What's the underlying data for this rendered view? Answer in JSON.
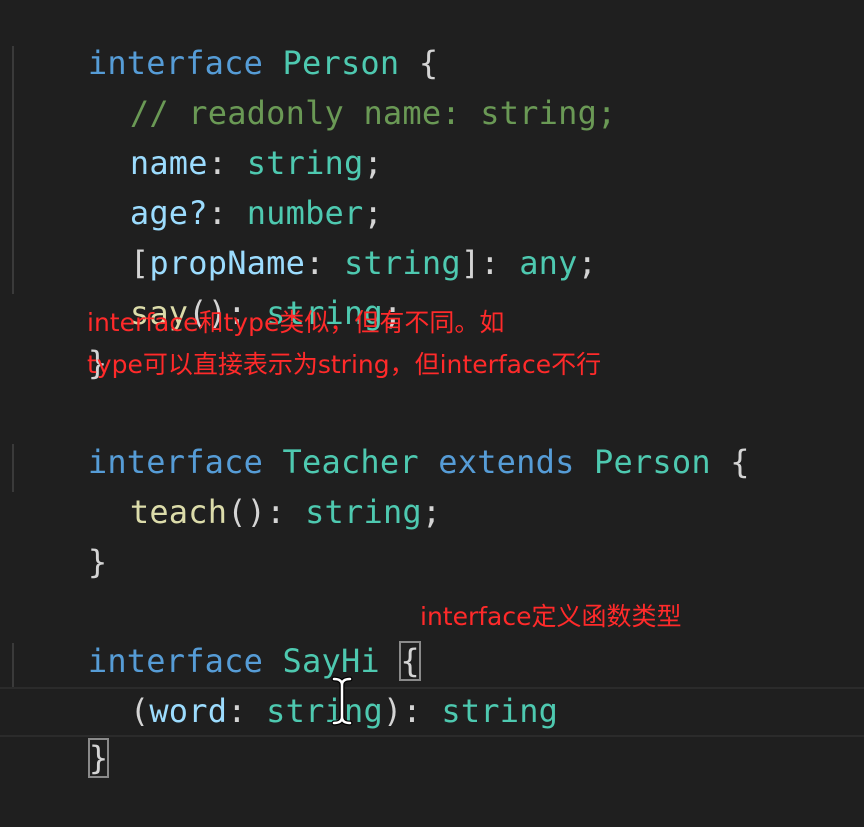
{
  "colors": {
    "background": "#1f1f1f",
    "keyword": "#569cd6",
    "type": "#4ec9b0",
    "property": "#9cdcfe",
    "function": "#dcdcaa",
    "comment": "#6a9955",
    "annotation": "#ff2a2a"
  },
  "code": {
    "person_kw": "interface",
    "person_name": "Person",
    "open_brace": "{",
    "close_brace": "}",
    "comment_line": "// readonly name: string;",
    "name_prop": "name",
    "age_prop": "age?",
    "propname_key": "propName",
    "any_type": "any",
    "say_fn": "say",
    "string_type": "string",
    "number_type": "number",
    "teacher_kw": "interface",
    "teacher_name": "Teacher",
    "extends_kw": "extends",
    "extends_target": "Person",
    "teach_fn": "teach",
    "sayhi_kw": "interface",
    "sayhi_name": "SayHi",
    "word_param": "word"
  },
  "annotations": {
    "note_line1": "interface和type类似，但有不同。如",
    "note_line2": "type可以直接表示为string，但interface不行",
    "note_fn": "interface定义函数类型"
  },
  "icons": {
    "cursor": "text-cursor-icon"
  }
}
